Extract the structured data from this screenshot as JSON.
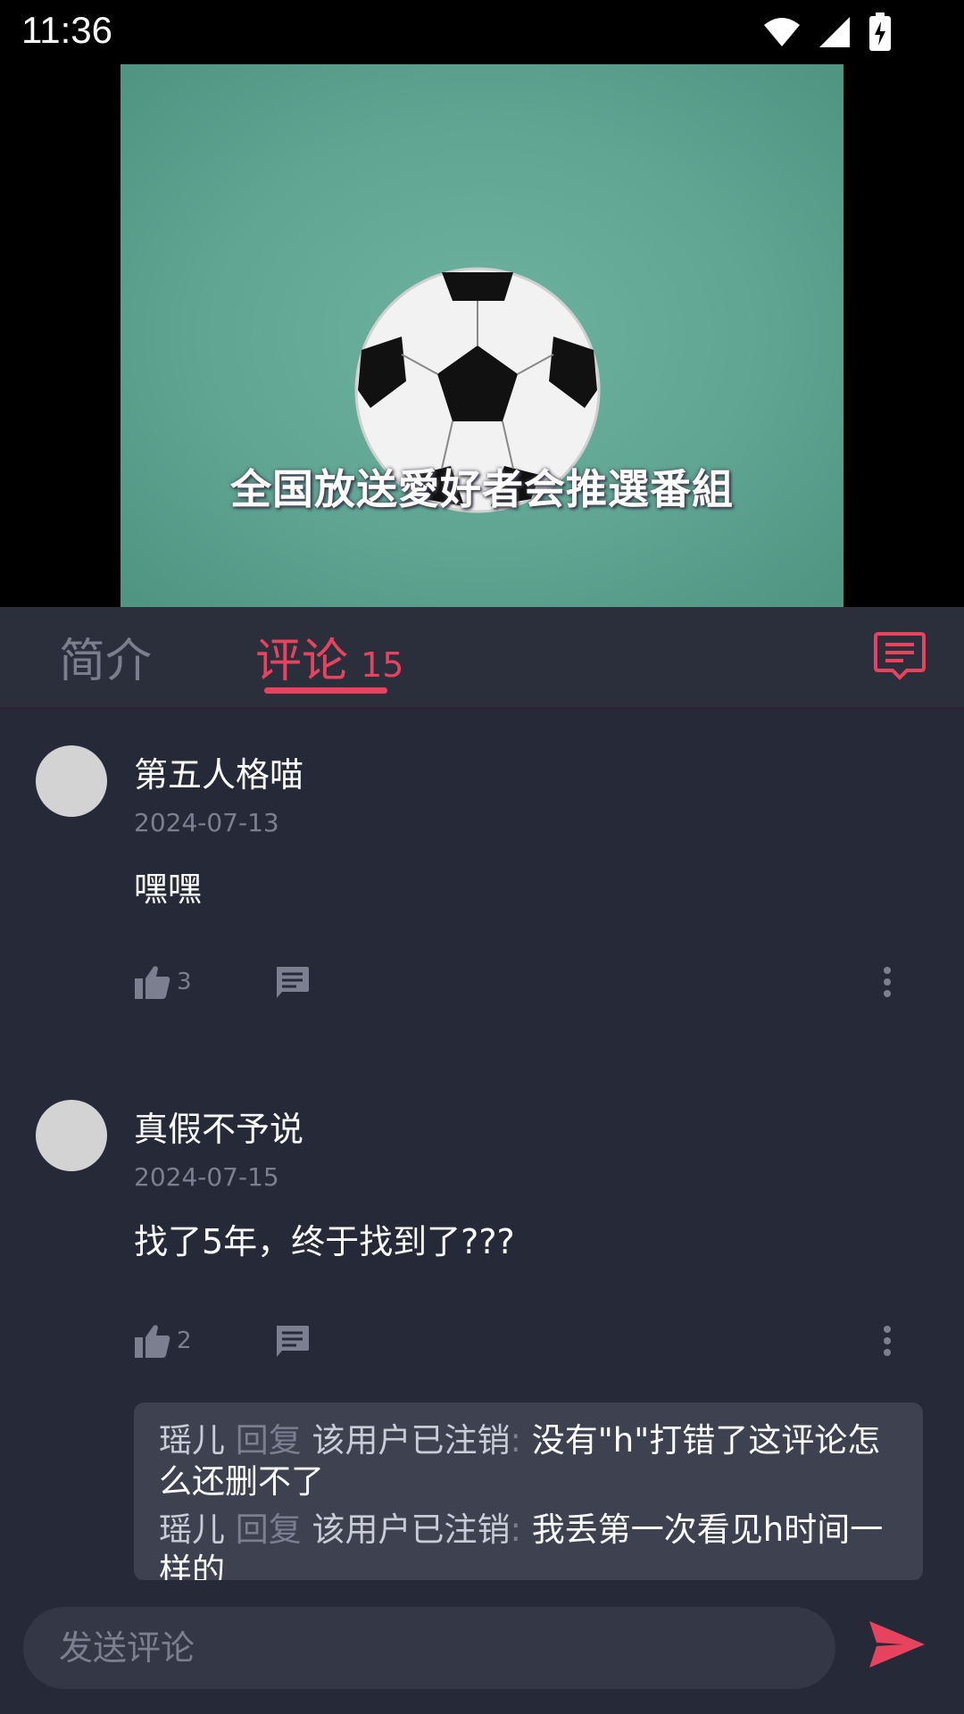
{
  "status_bar": {
    "time": "11:36"
  },
  "video": {
    "subtitle": "全国放送愛好者会推選番組"
  },
  "tabs": [
    {
      "label": "简介"
    },
    {
      "label": "评论",
      "count": "15"
    }
  ],
  "comments": [
    {
      "username": "第五人格喵",
      "date": "2024-07-13",
      "text": "嘿嘿",
      "likes": "3"
    },
    {
      "username": "真假不予说",
      "date": "2024-07-15",
      "text": "找了5年，终于找到了???",
      "likes": "2",
      "replies": [
        {
          "author": "瑶儿",
          "verb": "回复",
          "target": "该用户已注销",
          "text": "没有\"h\"打错了这评论怎么还删不了"
        },
        {
          "author": "瑶儿",
          "verb": "回复",
          "target": "该用户已注销",
          "text": "我丢第一次看见h时间一样的"
        }
      ]
    }
  ],
  "composer": {
    "placeholder": "发送评论"
  },
  "colors": {
    "accent": "#e8435e",
    "background": "#262a38",
    "muted": "#7b7f90"
  }
}
